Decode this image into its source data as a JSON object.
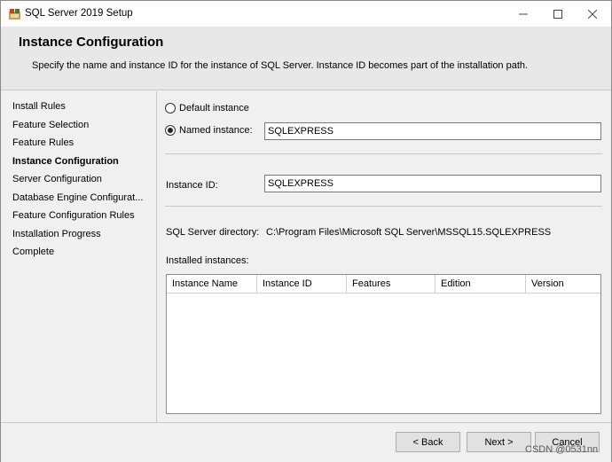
{
  "window": {
    "title": "SQL Server 2019 Setup",
    "icon": "sql-server-setup-icon",
    "controls": {
      "minimize": "minimize-icon",
      "maximize": "maximize-icon",
      "close": "close-icon"
    }
  },
  "header": {
    "title": "Instance Configuration",
    "description": "Specify the name and instance ID for the instance of SQL Server. Instance ID becomes part of the installation path."
  },
  "nav": {
    "items": [
      {
        "label": "Install Rules",
        "active": false
      },
      {
        "label": "Feature Selection",
        "active": false
      },
      {
        "label": "Feature Rules",
        "active": false
      },
      {
        "label": "Instance Configuration",
        "active": true
      },
      {
        "label": "Server Configuration",
        "active": false
      },
      {
        "label": "Database Engine Configurat...",
        "active": false
      },
      {
        "label": "Feature Configuration Rules",
        "active": false
      },
      {
        "label": "Installation Progress",
        "active": false
      },
      {
        "label": "Complete",
        "active": false
      }
    ]
  },
  "instance": {
    "default_label": "Default instance",
    "default_selected": false,
    "named_label": "Named instance:",
    "named_selected": true,
    "named_value": "SQLEXPRESS",
    "id_label": "Instance ID:",
    "id_value": "SQLEXPRESS",
    "directory_label": "SQL Server directory:",
    "directory_value": "C:\\Program Files\\Microsoft SQL Server\\MSSQL15.SQLEXPRESS",
    "installed_label": "Installed instances:"
  },
  "grid": {
    "columns": [
      "Instance Name",
      "Instance ID",
      "Features",
      "Edition",
      "Version"
    ],
    "rows": []
  },
  "footer": {
    "back_label": "< Back",
    "next_label": "Next >",
    "cancel_label": "Cancel"
  },
  "watermark": "CSDN @0531nn"
}
